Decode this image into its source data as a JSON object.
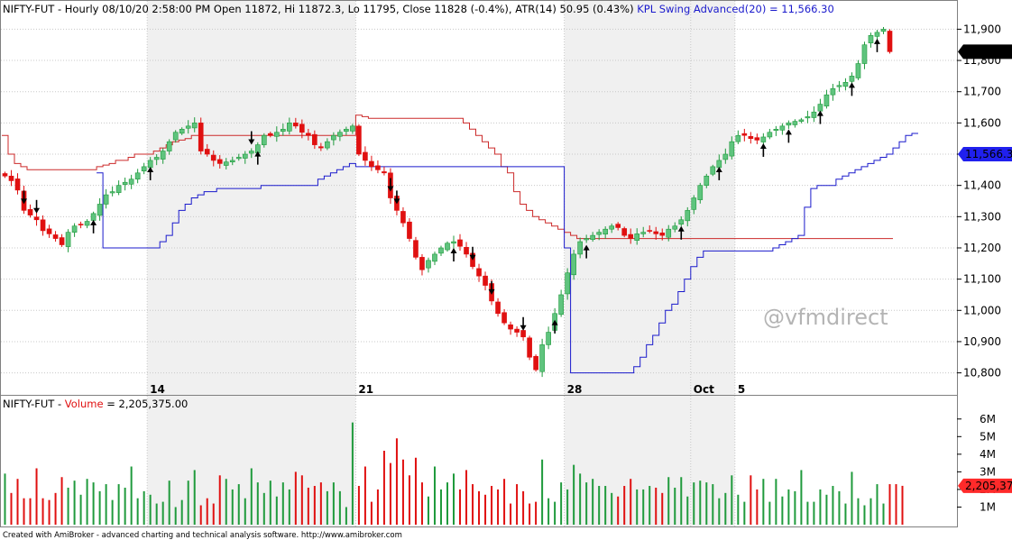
{
  "header": {
    "symbol": "NIFTY-FUT",
    "price_line": "- Hourly 08/10/20 2:58:00 PM Open 11872, Hi 11872.3, Lo 11795, Close 11828 (-0.4%), ATR(14) 50.95  (0.43%)",
    "indicator_line": "KPL Swing Advanced(20) = 11,566.30"
  },
  "volume_header": {
    "symbol": "NIFTY-FUT",
    "dash": " - ",
    "label": "Volume",
    "value": " = 2,205,375.00"
  },
  "watermark": "@vfmdirect",
  "footer": "Created with AmiBroker - advanced charting and technical analysis software. http://www.amibroker.com",
  "colors": {
    "up": "#1f9a3c",
    "up_body": "#5fc47e",
    "down": "#e01010",
    "swing_high": "#cc2a2a",
    "swing_low": "#1a1acc",
    "shade": "#f0f0f0",
    "grid": "#c8c8c8",
    "axis_tag_close": "#ff2a2a",
    "axis_tag_indicator": "#2020ee",
    "axis_tag_volume": "#ff2a2a"
  },
  "chart_data": [
    {
      "type": "candlestick",
      "title": "NIFTY-FUT Hourly",
      "ylim": [
        10770,
        11930
      ],
      "y_ticks": [
        10800,
        10900,
        11000,
        11100,
        11200,
        11300,
        11400,
        11500,
        11600,
        11700,
        11800,
        11900
      ],
      "y_tick_labels": [
        "10,800",
        "10,900",
        "11,000",
        "11,100",
        "11,200",
        "11,300",
        "11,400",
        "11,500",
        "11,600",
        "11,700",
        "11,800",
        "11,900"
      ],
      "x_date_labels": [
        {
          "label": "14",
          "bar": 23
        },
        {
          "label": "21",
          "bar": 56
        },
        {
          "label": "28",
          "bar": 89
        },
        {
          "label": "Oct",
          "bar": 109
        },
        {
          "label": "5",
          "bar": 116
        }
      ],
      "shaded_bar_ranges": [
        [
          23,
          56
        ],
        [
          89,
          116
        ]
      ],
      "close_tag": "11,828",
      "indicator_tag": "11,566.3",
      "closes": [
        11430,
        11415,
        11385,
        11320,
        11305,
        11290,
        11255,
        11245,
        11230,
        11210,
        11250,
        11270,
        11275,
        11285,
        11310,
        11340,
        11370,
        11380,
        11400,
        11410,
        11420,
        11440,
        11460,
        11480,
        11490,
        11510,
        11540,
        11570,
        11580,
        11590,
        11600,
        11510,
        11500,
        11480,
        11470,
        11475,
        11480,
        11490,
        11500,
        11510,
        11530,
        11560,
        11560,
        11570,
        11580,
        11600,
        11590,
        11570,
        11560,
        11530,
        11520,
        11540,
        11560,
        11570,
        11580,
        11590,
        11500,
        11480,
        11460,
        11450,
        11440,
        11360,
        11320,
        11280,
        11230,
        11170,
        11130,
        11160,
        11180,
        11200,
        11215,
        11220,
        11205,
        11180,
        11140,
        11110,
        11080,
        11030,
        10990,
        10960,
        10940,
        10930,
        10915,
        10850,
        10810,
        10890,
        10930,
        10990,
        11050,
        11120,
        11180,
        11220,
        11230,
        11240,
        11250,
        11260,
        11270,
        11265,
        11240,
        11230,
        11245,
        11250,
        11255,
        11245,
        11240,
        11260,
        11270,
        11290,
        11320,
        11360,
        11400,
        11430,
        11460,
        11480,
        11500,
        11540,
        11560,
        11560,
        11550,
        11545,
        11555,
        11570,
        11580,
        11590,
        11600,
        11605,
        11610,
        11620,
        11635,
        11660,
        11690,
        11710,
        11720,
        11730,
        11750,
        11790,
        11850,
        11880,
        11890,
        11900,
        11828
      ],
      "swing_high_line": [
        11560,
        11500,
        11470,
        11460,
        11450,
        11450,
        11450,
        11450,
        11450,
        11450,
        11450,
        11450,
        11450,
        11450,
        11450,
        11460,
        11465,
        11470,
        11480,
        11480,
        11490,
        11500,
        11500,
        11500,
        11510,
        11520,
        11530,
        11540,
        11545,
        11550,
        11560,
        11560,
        11560,
        11560,
        11560,
        11560,
        11560,
        11560,
        11560,
        11560,
        11560,
        11560,
        11560,
        11560,
        11560,
        11560,
        11560,
        11560,
        11560,
        11560,
        11560,
        11560,
        11560,
        11560,
        11560,
        11560,
        11625,
        11620,
        11615,
        11615,
        11615,
        11615,
        11615,
        11615,
        11615,
        11615,
        11615,
        11615,
        11615,
        11615,
        11615,
        11615,
        11615,
        11600,
        11580,
        11560,
        11540,
        11520,
        11500,
        11460,
        11440,
        11380,
        11340,
        11320,
        11300,
        11290,
        11280,
        11270,
        11260,
        11250,
        11240,
        11230,
        11230,
        11230,
        11230,
        11230,
        11230,
        11230,
        11230,
        11230,
        11230,
        11230,
        11230,
        11230,
        11230,
        11230,
        11230,
        11230,
        11230,
        11230,
        11230,
        11230,
        11230,
        11230,
        11230,
        11230,
        11230,
        11230,
        11230,
        11230,
        11230,
        11230,
        11230,
        11230,
        11230,
        11230,
        11230,
        11230,
        11230,
        11230,
        11230,
        11230,
        11230,
        11230,
        11230,
        11230,
        11230,
        11230,
        11230,
        11230,
        11230
      ],
      "swing_low_line": [
        null,
        null,
        null,
        null,
        null,
        null,
        null,
        null,
        null,
        null,
        null,
        null,
        null,
        null,
        null,
        11440,
        11200,
        11200,
        11200,
        11200,
        11200,
        11200,
        11200,
        11200,
        11200,
        11220,
        11240,
        11280,
        11320,
        11340,
        11360,
        11370,
        11380,
        11380,
        11390,
        11390,
        11390,
        11390,
        11390,
        11390,
        11390,
        11400,
        11400,
        11400,
        11400,
        11400,
        11400,
        11400,
        11400,
        11400,
        11420,
        11430,
        11440,
        11450,
        11460,
        11470,
        11460,
        11460,
        11460,
        11460,
        11460,
        11460,
        11460,
        11460,
        11460,
        11460,
        11460,
        11460,
        11460,
        11460,
        11460,
        11460,
        11460,
        11460,
        11460,
        11460,
        11460,
        11460,
        11460,
        11460,
        11460,
        11460,
        11460,
        11460,
        11460,
        11460,
        11460,
        11460,
        11460,
        11200,
        10800,
        10800,
        10800,
        10800,
        10800,
        10800,
        10800,
        10800,
        10800,
        10800,
        10820,
        10850,
        10890,
        10920,
        10960,
        11000,
        11020,
        11060,
        11100,
        11140,
        11170,
        11190,
        11190,
        11190,
        11190,
        11190,
        11190,
        11190,
        11190,
        11190,
        11190,
        11190,
        11200,
        11210,
        11220,
        11230,
        11240,
        11330,
        11390,
        11400,
        11400,
        11400,
        11420,
        11430,
        11440,
        11450,
        11460,
        11470,
        11480,
        11490,
        11500,
        11520,
        11540,
        11560,
        11566.3
      ],
      "arrows_up": [
        14,
        23,
        40,
        71,
        87,
        92,
        107,
        113,
        120,
        124,
        129,
        134,
        138,
        146
      ],
      "arrows_down": [
        3,
        5,
        39,
        61,
        62,
        74,
        77,
        82
      ]
    },
    {
      "type": "bar",
      "title": "Volume",
      "ylim": [
        0,
        6500000
      ],
      "y_ticks": [
        1000000,
        2000000,
        3000000,
        4000000,
        5000000,
        6000000
      ],
      "y_tick_labels": [
        "1M",
        "2M",
        "3M",
        "4M",
        "5M",
        "6M"
      ],
      "value_tag": "2,205,375",
      "values": [
        2900000,
        1800000,
        2600000,
        1500000,
        1500000,
        3200000,
        1500000,
        1400000,
        1800000,
        2700000,
        2100000,
        2500000,
        1700000,
        2600000,
        2400000,
        1900000,
        2300000,
        1400000,
        2300000,
        2100000,
        3300000,
        1500000,
        1900000,
        1700000,
        1200000,
        1300000,
        2500000,
        1000000,
        1400000,
        2500000,
        3100000,
        1100000,
        1500000,
        1200000,
        2800000,
        2600000,
        2000000,
        2300000,
        1500000,
        3200000,
        2400000,
        1800000,
        2500000,
        1600000,
        2400000,
        2000000,
        3000000,
        2800000,
        2100000,
        2200000,
        2400000,
        1900000,
        2400000,
        1900000,
        1000000,
        5800000,
        2200000,
        3300000,
        1300000,
        2000000,
        4200000,
        3500000,
        4900000,
        3700000,
        2800000,
        3800000,
        2400000,
        1600000,
        3300000,
        2000000,
        2400000,
        2900000,
        2000000,
        3100000,
        2300000,
        1900000,
        1700000,
        2200000,
        2000000,
        2600000,
        1200000,
        2300000,
        1900000,
        1200000,
        1300000,
        3700000,
        1500000,
        1300000,
        2400000,
        2000000,
        3400000,
        2900000,
        2400000,
        2600000,
        2200000,
        2200000,
        1800000,
        1600000,
        2200000,
        2600000,
        2000000,
        2000000,
        2200000,
        2100000,
        1800000,
        2700000,
        2100000,
        2700000,
        1600000,
        2400000,
        2500000,
        2400000,
        2300000,
        1500000,
        1800000,
        2800000,
        1700000,
        1300000,
        2800000,
        2000000,
        2600000,
        1300000,
        2600000,
        1600000,
        2000000,
        1900000,
        3100000,
        1300000,
        1300000,
        2000000,
        1700000,
        2200000,
        1900000,
        1200000,
        3000000,
        1500000,
        1100000,
        1500000,
        2300000,
        1200000,
        2300000,
        2300000,
        2205375
      ]
    }
  ]
}
